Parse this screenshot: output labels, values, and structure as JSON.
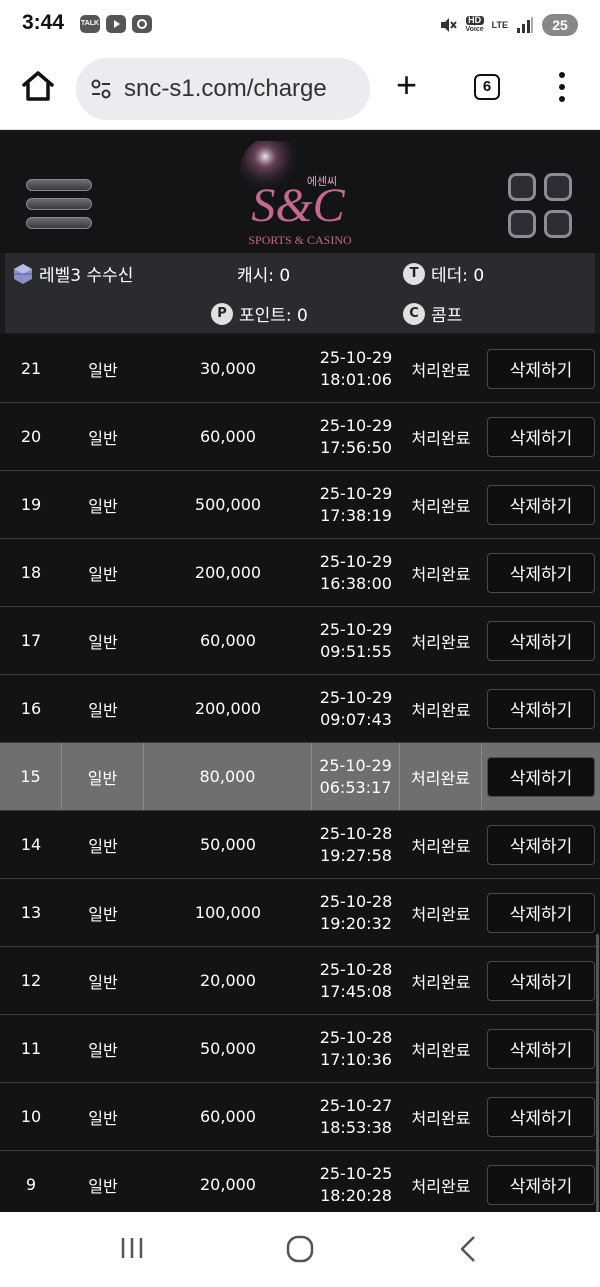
{
  "status_bar": {
    "time": "3:44",
    "notifications": [
      {
        "icon": "kakaotalk-icon",
        "text": "TALK"
      },
      {
        "icon": "youtube-icon",
        "text": ""
      },
      {
        "icon": "samsung-game-icon",
        "text": ""
      }
    ],
    "hd_label": "HD",
    "voice_label": "Voice",
    "network_label": "LTE",
    "battery": "25"
  },
  "browser": {
    "url": "snc-s1.com/charge",
    "tab_count": "6",
    "icons": [
      "home-icon",
      "site-settings-icon",
      "new-tab-icon",
      "tabs-icon",
      "more-icon"
    ]
  },
  "header": {
    "logo_main": "S&C",
    "logo_korean": "에센씨",
    "logo_subtitle": "SPORTS & CASINO"
  },
  "info": {
    "level": "레벨3 수수신",
    "cash": "캐시: 0",
    "tether": "테더: 0",
    "points": "포인트: 0",
    "comp": "콤프",
    "tether_badge": "T",
    "points_badge": "P",
    "comp_badge": "C"
  },
  "rows": [
    {
      "no": "21",
      "type": "일반",
      "amount": "30,000",
      "date": "25-10-29",
      "time": "18:01:06",
      "status": "처리완료",
      "action": "삭제하기"
    },
    {
      "no": "20",
      "type": "일반",
      "amount": "60,000",
      "date": "25-10-29",
      "time": "17:56:50",
      "status": "처리완료",
      "action": "삭제하기"
    },
    {
      "no": "19",
      "type": "일반",
      "amount": "500,000",
      "date": "25-10-29",
      "time": "17:38:19",
      "status": "처리완료",
      "action": "삭제하기"
    },
    {
      "no": "18",
      "type": "일반",
      "amount": "200,000",
      "date": "25-10-29",
      "time": "16:38:00",
      "status": "처리완료",
      "action": "삭제하기"
    },
    {
      "no": "17",
      "type": "일반",
      "amount": "60,000",
      "date": "25-10-29",
      "time": "09:51:55",
      "status": "처리완료",
      "action": "삭제하기"
    },
    {
      "no": "16",
      "type": "일반",
      "amount": "200,000",
      "date": "25-10-29",
      "time": "09:07:43",
      "status": "처리완료",
      "action": "삭제하기"
    },
    {
      "no": "15",
      "type": "일반",
      "amount": "80,000",
      "date": "25-10-29",
      "time": "06:53:17",
      "status": "처리완료",
      "action": "삭제하기",
      "highlighted": true
    },
    {
      "no": "14",
      "type": "일반",
      "amount": "50,000",
      "date": "25-10-28",
      "time": "19:27:58",
      "status": "처리완료",
      "action": "삭제하기"
    },
    {
      "no": "13",
      "type": "일반",
      "amount": "100,000",
      "date": "25-10-28",
      "time": "19:20:32",
      "status": "처리완료",
      "action": "삭제하기"
    },
    {
      "no": "12",
      "type": "일반",
      "amount": "20,000",
      "date": "25-10-28",
      "time": "17:45:08",
      "status": "처리완료",
      "action": "삭제하기"
    },
    {
      "no": "11",
      "type": "일반",
      "amount": "50,000",
      "date": "25-10-28",
      "time": "17:10:36",
      "status": "처리완료",
      "action": "삭제하기"
    },
    {
      "no": "10",
      "type": "일반",
      "amount": "60,000",
      "date": "25-10-27",
      "time": "18:53:38",
      "status": "처리완료",
      "action": "삭제하기"
    },
    {
      "no": "9",
      "type": "일반",
      "amount": "20,000",
      "date": "25-10-25",
      "time": "18:20:28",
      "status": "처리완료",
      "action": "삭제하기"
    }
  ],
  "nav_bar": {
    "icons": [
      "recent-apps-icon",
      "home-circle-icon",
      "back-icon"
    ]
  },
  "colors": {
    "page_bg": "#131315",
    "panel_bg": "#2a2b2f",
    "highlight_row": "#6f6f72",
    "logo_pink": "#c46a8e"
  }
}
